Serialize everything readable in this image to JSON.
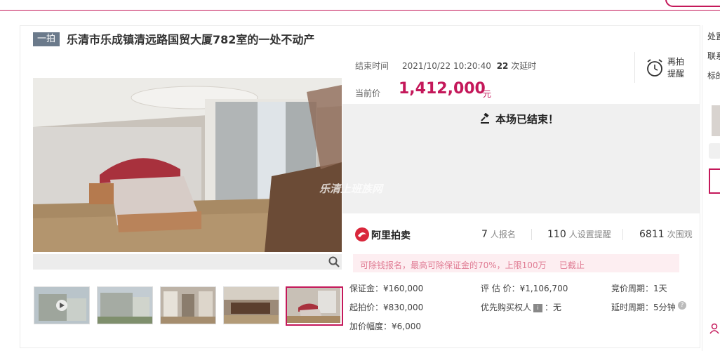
{
  "header": {
    "tag": "一拍",
    "title": "乐清市乐成镇清远路国贸大厦782室的一处不动产"
  },
  "auction": {
    "end_label": "结束时间",
    "end_time": "2021/10/22 10:20:40",
    "delay_count": "22",
    "delay_label": "次延时",
    "current_label": "当前价",
    "current_price": "1,412,000",
    "currency": "元",
    "remind_line1": "再拍",
    "remind_line2": "提醒",
    "ended_text": "本场已结束！"
  },
  "watermark": "乐清上班族网",
  "platform": "阿里拍卖",
  "stats": {
    "signup_count": "7",
    "signup_label": "人报名",
    "remind_count": "110",
    "remind_label": "人设置提醒",
    "view_count": "6811",
    "view_label": "次围观"
  },
  "deposit_notice": {
    "text": "可除钱报名，最高可除保证金的70%，上限100万",
    "status": "已截止"
  },
  "details": {
    "deposit": "保证金：¥160,000",
    "start_price": "起拍价：¥830,000",
    "increment": "加价幅度：¥6,000",
    "appraisal": "评 估 价：¥1,106,700",
    "priority_label": "优先购买权人",
    "priority_value": "：无",
    "cycle": "竞价周期：1天",
    "delay_cycle": "延时周期：5分钟"
  },
  "right_panel": {
    "line1": "处置",
    "line2": "联系",
    "line3": "标的"
  },
  "colors": {
    "accent": "#c4185a",
    "tag_bg": "#6b7a8b"
  }
}
